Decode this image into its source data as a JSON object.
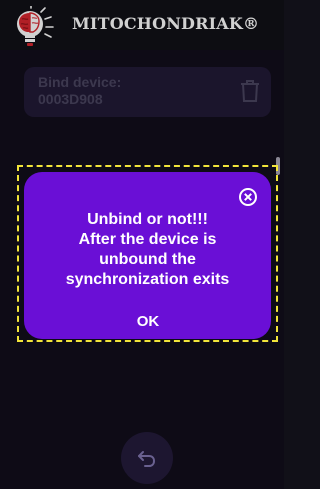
{
  "header": {
    "app_title": "MITOCHONDRIAK®",
    "logo_icon": "brain-lightbulb-icon"
  },
  "device_card": {
    "label": "Bind device:",
    "device_id": "0003D908",
    "delete_icon": "trash-icon"
  },
  "dialog": {
    "message_lines": [
      "Unbind or not!!!",
      "After the device is",
      "unbound the",
      "synchronization exits"
    ],
    "ok_label": "OK",
    "close_icon": "close-circle-icon",
    "background_color": "#6a0fd6"
  },
  "footer": {
    "back_icon": "undo-arrow-icon"
  },
  "colors": {
    "background": "#120e1c",
    "card": "#221a36",
    "highlight_outline": "#f2e53a"
  }
}
